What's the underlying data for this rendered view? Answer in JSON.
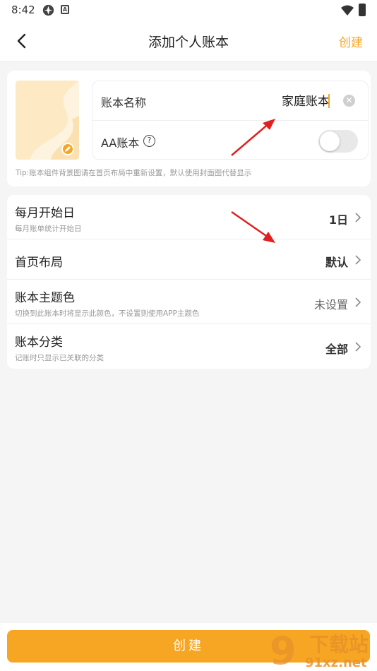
{
  "status_bar": {
    "time": "8:42"
  },
  "header": {
    "title": "添加个人账本",
    "create_label": "创建"
  },
  "book_card": {
    "name_label": "账本名称",
    "name_value": "家庭账本",
    "aa_label": "AA账本",
    "aa_enabled": false,
    "tip": "Tip:账本组件背景图请在首页布局中重新设置，默认使用封面图代替显示"
  },
  "settings": [
    {
      "title": "每月开始日",
      "subtitle": "每月账单统计开始日",
      "value": "1日"
    },
    {
      "title": "首页布局",
      "subtitle": "",
      "value": "默认"
    },
    {
      "title": "账本主题色",
      "subtitle": "切换到此账本时将显示此颜色，不设置则使用APP主题色",
      "value": "未设置"
    },
    {
      "title": "账本分类",
      "subtitle": "记账时只显示已关联的分类",
      "value": "全部"
    }
  ],
  "bottom": {
    "create_button_label": "创建"
  },
  "colors": {
    "accent": "#f6a623",
    "background": "#f5f5f5",
    "annotation_arrow": "#e02020"
  },
  "watermark": {
    "line1": "下载站",
    "line2": "91xz.net"
  }
}
